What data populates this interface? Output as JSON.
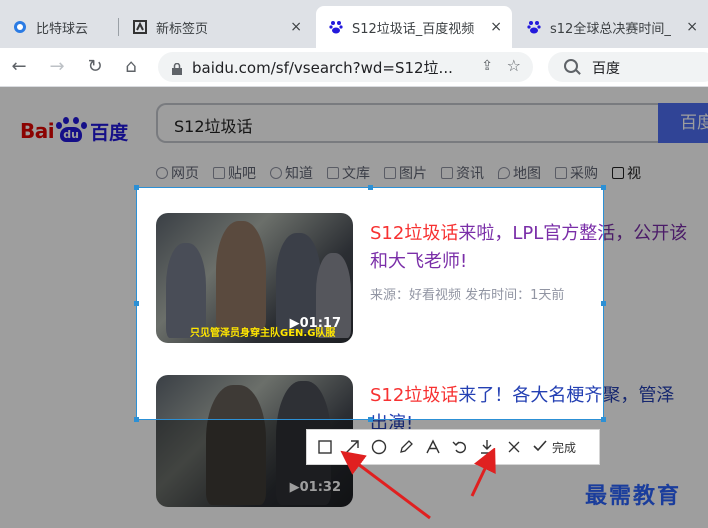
{
  "browser": {
    "tabs": [
      {
        "title": "比特球云",
        "favicon": "blue-circle-icon",
        "closable": false
      },
      {
        "title": "新标签页",
        "favicon": "newtab-icon",
        "closable": true
      },
      {
        "title": "S12垃圾话_百度视频",
        "favicon": "baidu-paw-icon",
        "closable": true,
        "active": true
      },
      {
        "title": "s12全球总决赛时间_",
        "favicon": "baidu-paw-icon",
        "closable": true
      }
    ],
    "close_glyph": "×",
    "url": "baidu.com/sf/vsearch?wd=S12垃...",
    "search_engine": "百度"
  },
  "page": {
    "logo": {
      "bai": "Bai",
      "du": "du",
      "name": "百度"
    },
    "query": "S12垃圾话",
    "search_button": "百度",
    "tabs": [
      "网页",
      "贴吧",
      "知道",
      "文库",
      "图片",
      "资讯",
      "地图",
      "采购",
      "视"
    ],
    "results": [
      {
        "title_highlight": "S12垃圾话",
        "title_rest": "来啦，LPL官方整活，公开该",
        "title_line2": "和大飞老师!",
        "meta": "来源：好看视频   发布时间：1天前",
        "duration": "01:17",
        "caption": "只见管泽员身穿主队GEN.G队服"
      },
      {
        "title_highlight": "S12垃圾话",
        "title_rest": "来了！各大名梗齐聚，管泽",
        "title_line2": "出演!",
        "duration": "01:32"
      }
    ]
  },
  "screenshot_toolbar": {
    "tools": [
      "rectangle-icon",
      "arrow-icon",
      "ellipse-icon",
      "pencil-icon",
      "text-icon",
      "undo-icon",
      "download-icon",
      "cancel-icon",
      "confirm-icon"
    ],
    "done_label": "完成"
  },
  "watermark": "最需教育",
  "colors": {
    "selection": "#2c90d5",
    "annotation_arrow": "#e02020",
    "baidu_red": "#e10602",
    "baidu_blue": "#2319dc",
    "search_button": "#4e6ef2"
  }
}
